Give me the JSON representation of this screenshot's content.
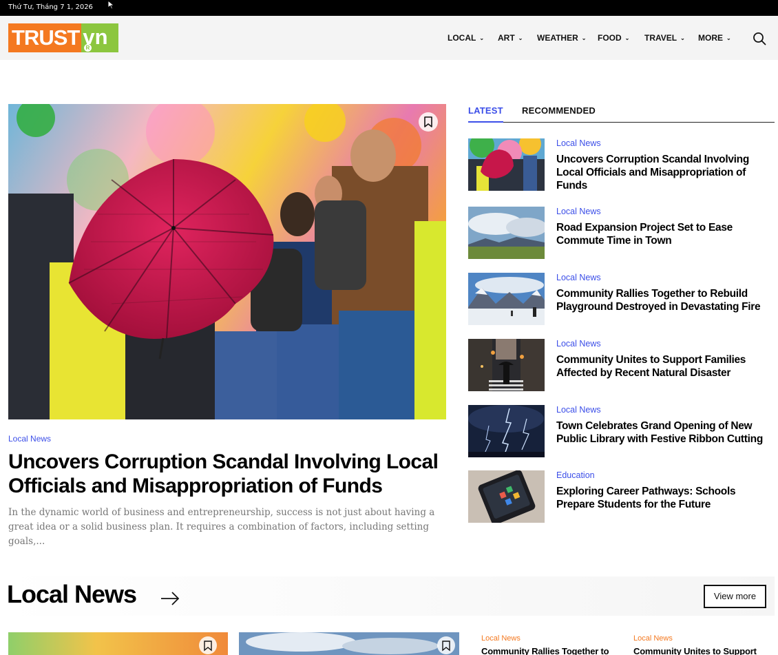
{
  "topbar": {
    "date": "Thứ Tư, Tháng 7 1, 2026"
  },
  "brand": {
    "logo_left": "TRUST",
    "logo_right": "vn",
    "logo_mark": "R"
  },
  "nav": {
    "items": [
      {
        "label": "LOCAL"
      },
      {
        "label": "ART"
      },
      {
        "label": "WEATHER"
      },
      {
        "label": "FOOD"
      },
      {
        "label": "TRAVEL"
      },
      {
        "label": "MORE"
      }
    ],
    "search_icon": "search-icon"
  },
  "hero": {
    "category": "Local News",
    "title": "Uncovers Corruption Scandal Involving Local Officials and Misappropriation of Funds",
    "excerpt": "In the dynamic world of business and entrepreneurship, success is not just about having a great idea or a solid business plan. It requires a combination of factors, including setting goals,..."
  },
  "tabs": [
    {
      "label": "LATEST",
      "active": true
    },
    {
      "label": "RECOMMENDED",
      "active": false
    }
  ],
  "latest": [
    {
      "category": "Local News",
      "title": "Uncovers Corruption Scandal Involving Local Officials and Misappropriation of Funds"
    },
    {
      "category": "Local News",
      "title": "Road Expansion Project Set to Ease Commute Time in Town"
    },
    {
      "category": "Local News",
      "title": "Community Rallies Together to Rebuild Playground Destroyed in Devastating Fire"
    },
    {
      "category": "Local News",
      "title": "Community Unites to Support Families Affected by Recent Natural Disaster"
    },
    {
      "category": "Local News",
      "title": "Town Celebrates Grand Opening of New Public Library with Festive Ribbon Cutting"
    },
    {
      "category": "Education",
      "title": "Exploring Career Pathways: Schools Prepare Students for the Future"
    }
  ],
  "section": {
    "title": "Local News",
    "view_more": "View more",
    "mini": [
      {
        "category": "Local News",
        "title": "Community Rallies Together to"
      },
      {
        "category": "Local News",
        "title": "Community Unites to Support"
      }
    ]
  },
  "colors": {
    "accent": "#3b4ee8",
    "brand_orange": "#f47920",
    "brand_green": "#8cc63f"
  }
}
